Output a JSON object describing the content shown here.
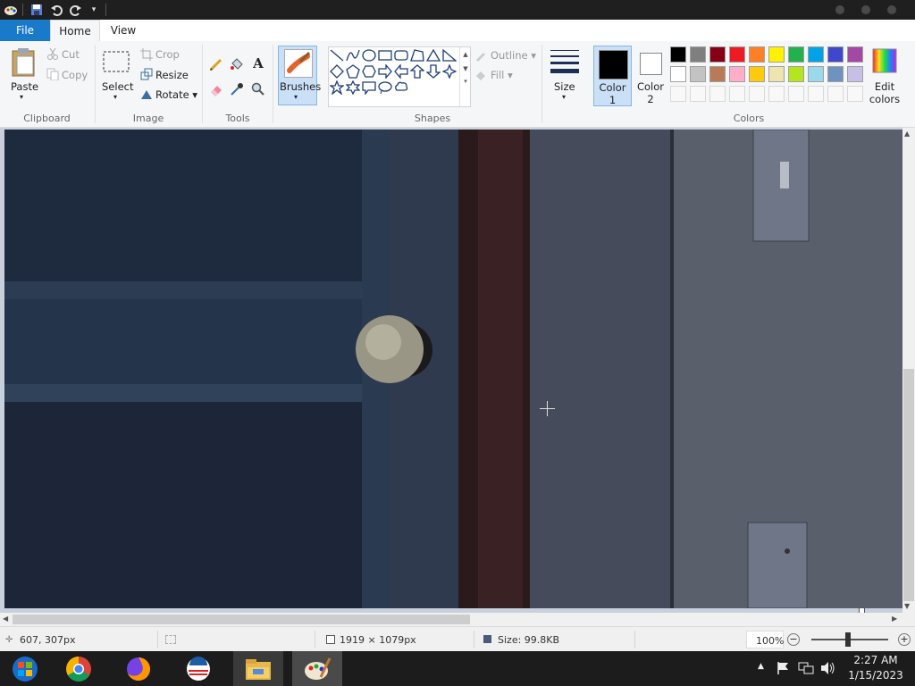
{
  "ribbon": {
    "tabs": {
      "file": "File",
      "home": "Home",
      "view": "View"
    },
    "clipboard": {
      "paste": "Paste",
      "cut": "Cut",
      "copy": "Copy",
      "group": "Clipboard"
    },
    "image": {
      "select": "Select",
      "crop": "Crop",
      "resize": "Resize",
      "rotate": "Rotate",
      "group": "Image"
    },
    "tools": {
      "group": "Tools"
    },
    "brushes": {
      "label": "Brushes"
    },
    "shapes": {
      "outline": "Outline",
      "fill": "Fill",
      "group": "Shapes"
    },
    "size": {
      "label": "Size"
    },
    "color1": {
      "label": "Color",
      "num": "1",
      "color": "#000000"
    },
    "color2": {
      "label": "Color",
      "num": "2",
      "color": "#ffffff"
    },
    "colors": {
      "group": "Colors",
      "edit_line1": "Edit",
      "edit_line2": "colors"
    },
    "palette_row1": [
      "#000000",
      "#7f7f7f",
      "#880015",
      "#ed1c24",
      "#ff7f27",
      "#fff200",
      "#22b14c",
      "#00a2e8",
      "#3f48cc",
      "#a349a4"
    ],
    "palette_row2": [
      "#ffffff",
      "#c3c3c3",
      "#b97a57",
      "#ffaec9",
      "#ffc90e",
      "#efe4b0",
      "#b5e61d",
      "#99d9ea",
      "#7092be",
      "#c8bfe7"
    ]
  },
  "status": {
    "cursor_pos": "607, 307px",
    "dimensions": "1919 × 1079px",
    "size": "Size: 99.8KB",
    "zoom": "100%"
  },
  "taskbar": {
    "time": "2:27 AM",
    "date": "1/15/2023"
  },
  "icons": [
    "paint-app-icon",
    "save-icon",
    "undo-icon",
    "redo-icon",
    "paste-icon",
    "cut-icon",
    "copy-icon",
    "select-icon",
    "crop-icon",
    "resize-icon",
    "rotate-icon",
    "pencil-icon",
    "fill-bucket-icon",
    "text-icon",
    "eraser-icon",
    "color-picker-icon",
    "magnifier-icon",
    "brush-icon",
    "size-icon",
    "edit-colors-icon",
    "chrome-icon",
    "firefox-icon",
    "browser-icon",
    "file-explorer-icon",
    "paint-taskbar-icon",
    "flag-icon",
    "network-icon",
    "volume-icon"
  ]
}
